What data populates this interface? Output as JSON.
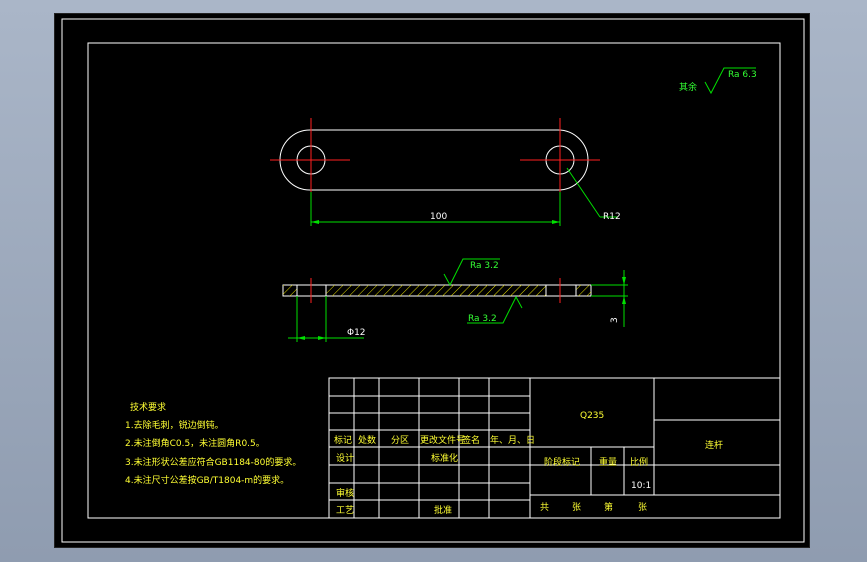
{
  "drawing": {
    "roughness_rest": {
      "prefix": "其余",
      "value": "Ra 6.3"
    },
    "dimensions": {
      "center_distance": "100",
      "end_radius": "R12",
      "hole_diameter": "Φ12",
      "thickness": "3",
      "roughness_top": "Ra 3.2",
      "roughness_bottom": "Ra 3.2"
    }
  },
  "tech_requirements": {
    "title": "技术要求",
    "items": [
      "1.去除毛刺，锐边倒钝。",
      "2.未注倒角C0.5，未注圆角R0.5。",
      "3.未注形状公差应符合GB1184-80的要求。",
      "4.未注尺寸公差按GB/T1804-m的要求。"
    ]
  },
  "title_block": {
    "material": "Q235",
    "part_name": "连杆",
    "rev_headers": [
      "标记",
      "处数",
      "分区",
      "更改文件号",
      "签名",
      "年、月、日"
    ],
    "roles": {
      "design": "设计",
      "standardize": "标准化",
      "review": "审核",
      "process": "工艺",
      "approve": "批准"
    },
    "stage_mark": "阶段标记",
    "weight": "重量",
    "scale_label": "比例",
    "scale_value": "10:1",
    "sheets": [
      "共",
      "张",
      "第",
      "张"
    ]
  },
  "colors": {
    "background": "#000000",
    "outline": "#ffffff",
    "dimension": "#00e000",
    "centerline": "#ff2020",
    "hatch": "#e8e000",
    "annotation_text": "#33ff33"
  }
}
